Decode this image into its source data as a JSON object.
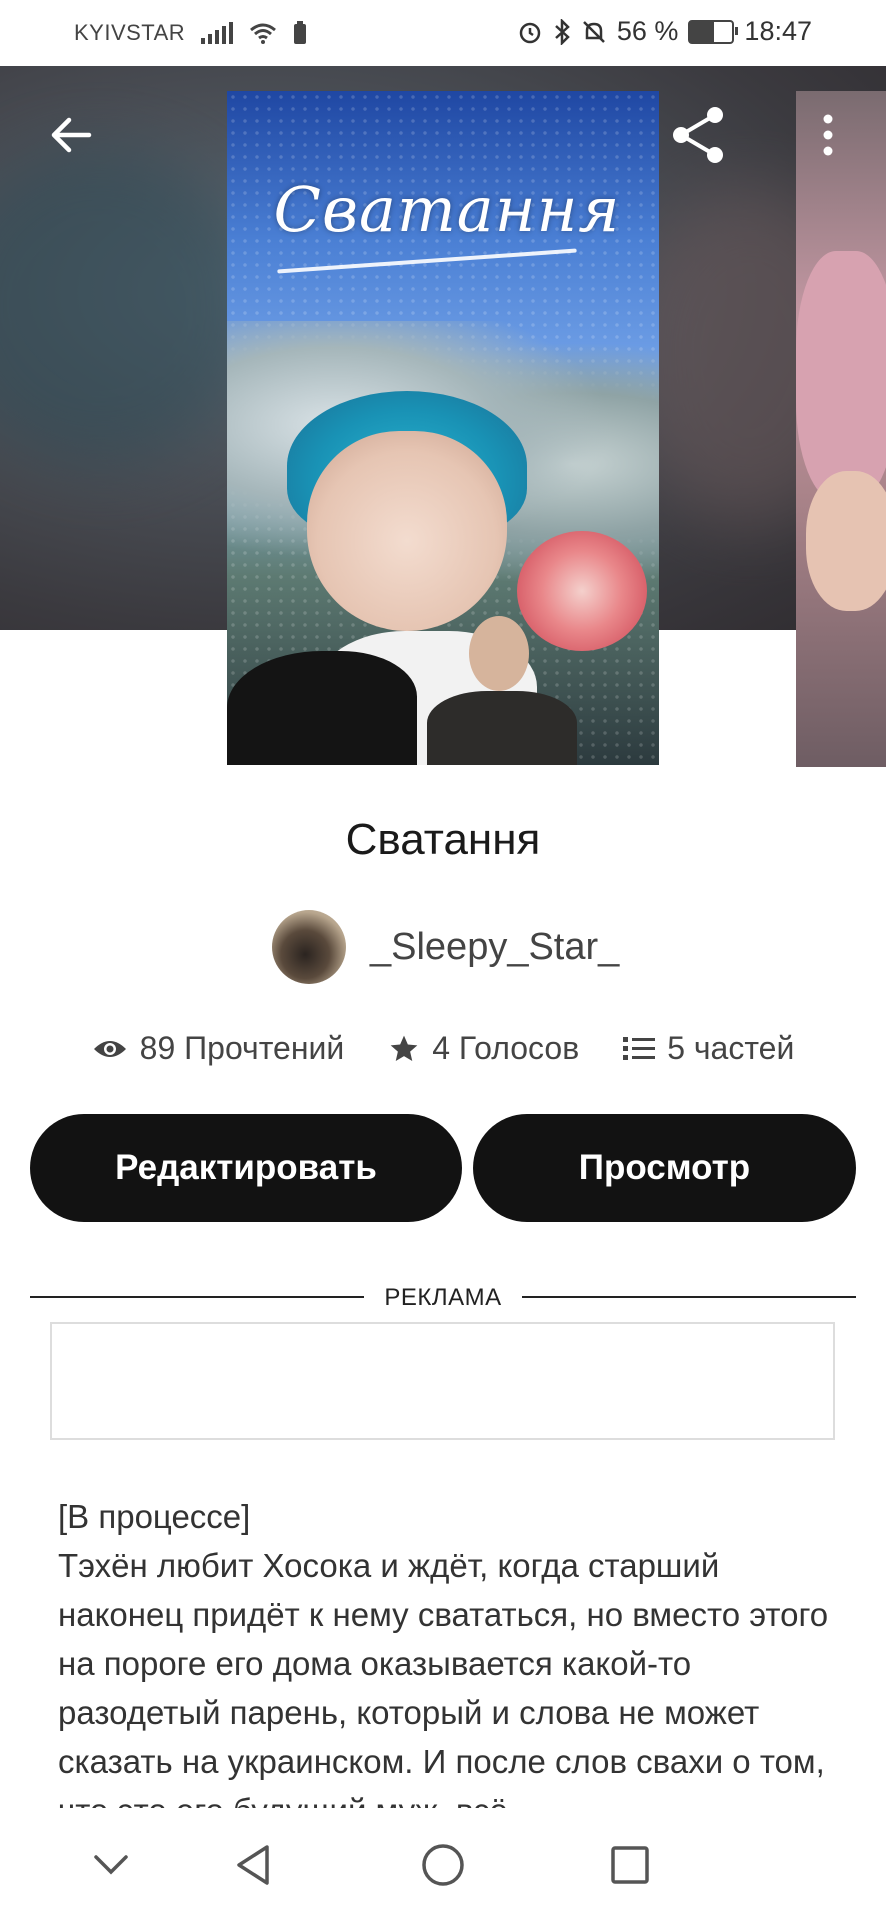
{
  "status_bar": {
    "carrier": "KYIVSTAR",
    "battery_percent": "56 %",
    "battery_level": 0.56,
    "time": "18:47",
    "icons": [
      "signal-icon",
      "wifi-icon",
      "battery-saver-icon",
      "alarm-icon",
      "bluetooth-icon",
      "mute-icon",
      "battery-icon"
    ]
  },
  "toolbar": {
    "back_icon": "arrow-left-icon",
    "share_icon": "share-icon",
    "menu_icon": "more-vertical-icon"
  },
  "cover": {
    "title_text": "Сватання"
  },
  "book": {
    "title": "Сватання",
    "author": "_Sleepy_Star_"
  },
  "stats": {
    "reads": "89 Прочтений",
    "votes": "4 Голосов",
    "parts": "5 частей",
    "icons": [
      "eye-icon",
      "star-icon",
      "list-icon"
    ]
  },
  "buttons": {
    "edit": "Редактировать",
    "view": "Просмотр"
  },
  "ad": {
    "label": "РЕКЛАМА"
  },
  "description": {
    "status": "[В процессе]",
    "text": "Тэхён любит Хосока и ждёт, когда старший наконец придёт к нему свататься, но вместо этого на пороге его дома оказывается какой-то разодетый парень, который и слова не может сказать на украинском. И после слов свахи о том, что это его будущий муж, всё"
  },
  "nav": {
    "icons": [
      "chevron-down-icon",
      "back-triangle-icon",
      "home-circle-icon",
      "recents-square-icon"
    ]
  },
  "colors": {
    "button_bg": "#121212",
    "button_text": "#ffffff",
    "text": "#333333"
  }
}
